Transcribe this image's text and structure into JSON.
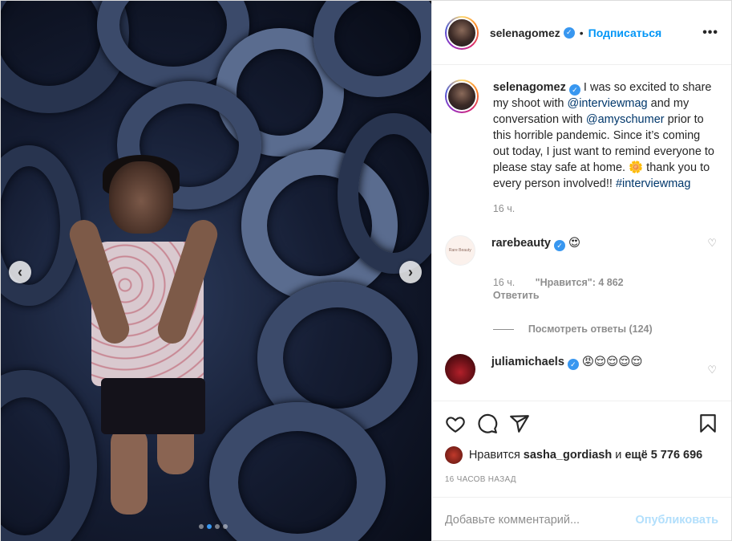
{
  "header": {
    "username": "selenagomez",
    "verified_badge": "✓",
    "separator": "•",
    "follow_label": "Подписаться",
    "more_label": "•••"
  },
  "caption": {
    "username": "selenagomez",
    "text_1": " I was so excited to share my shoot with ",
    "mention_1": "@interviewmag",
    "text_2": " and my conversation with ",
    "mention_2": "@amyschumer",
    "text_3": " prior to this horrible pandemic. Since it’s coming out today, I just want to remind everyone to please stay safe at home. ",
    "emoji": "🌼",
    "text_4": " thank you to every person involved!! ",
    "hashtag": "#interviewmag",
    "time": "16 ч."
  },
  "comments": [
    {
      "username": "rarebeauty",
      "avatar_text": "Rare Beauty",
      "emoji": "😍",
      "time": "16 ч.",
      "likes": "\"Нравится\": 4 862",
      "reply_label": "Ответить",
      "view_replies": "Посмотреть ответы (124)"
    },
    {
      "username": "juliamichaels",
      "emoji": "😡😌😌😌😌"
    }
  ],
  "actions": {
    "liked_by_prefix": "Нравится",
    "liked_by_user": "sasha_gordiash",
    "liked_and": "и",
    "likes_count": "ещё 5 776 696",
    "timestamp": "16 часов назад"
  },
  "add_comment": {
    "placeholder": "Добавьте комментарий...",
    "publish_label": "Опубликовать"
  },
  "media": {
    "prev_icon": "‹",
    "next_icon": "›",
    "slide_count": 4,
    "active_slide": 2
  },
  "colors": {
    "accent": "#0095f6",
    "publish_disabled": "#b2dffc",
    "muted": "#8e8e8e",
    "text": "#262626"
  }
}
